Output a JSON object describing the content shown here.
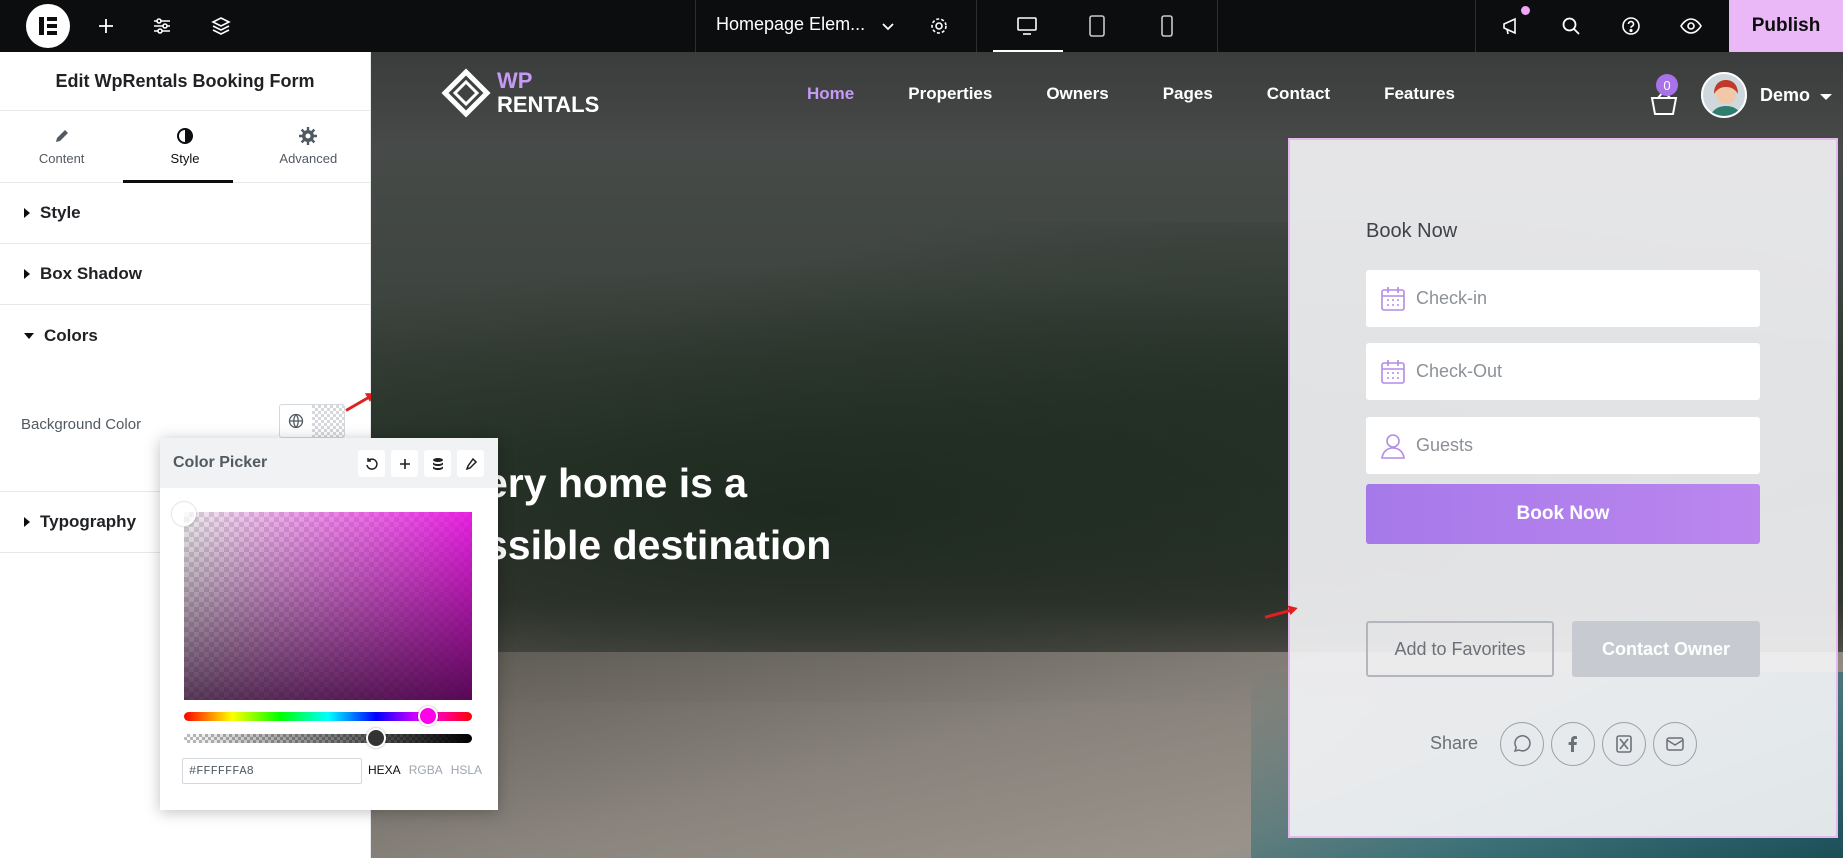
{
  "topbar": {
    "document_title": "Homepage Elem...",
    "publish_label": "Publish",
    "icons": [
      "elementor-logo-icon",
      "plus-icon",
      "sliders-icon",
      "layers-icon",
      "chevron-down-icon",
      "gear-icon",
      "desktop-icon",
      "tablet-icon",
      "mobile-icon",
      "megaphone-icon",
      "search-icon",
      "help-icon",
      "eye-icon"
    ]
  },
  "panel": {
    "title": "Edit WpRentals Booking Form",
    "tabs": [
      {
        "label": "Content",
        "icon": "pencil-icon"
      },
      {
        "label": "Style",
        "icon": "half-circle-icon"
      },
      {
        "label": "Advanced",
        "icon": "gear-icon"
      }
    ],
    "active_tab": "Style",
    "sections": {
      "style": "Style",
      "box_shadow": "Box Shadow",
      "colors": "Colors",
      "typography": "Typography"
    },
    "background_color_label": "Background Color"
  },
  "color_picker": {
    "title": "Color Picker",
    "hex_value": "#FFFFFFA8",
    "formats": [
      "HEXA",
      "RGBA",
      "HSLA"
    ],
    "active_format": "HEXA"
  },
  "site": {
    "logo": {
      "line1": "WP",
      "line2": "RENTALS"
    },
    "nav": [
      "Home",
      "Properties",
      "Owners",
      "Pages",
      "Contact",
      "Features"
    ],
    "active_nav": "Home",
    "cart_count": "0",
    "user_name": "Demo",
    "hero_line1": "ery home is a",
    "hero_line2": "ssible destination"
  },
  "booking_form": {
    "title": "Book Now",
    "checkin_placeholder": "Check-in",
    "checkout_placeholder": "Check-Out",
    "guests_placeholder": "Guests",
    "book_button": "Book Now",
    "favorites_button": "Add to Favorites",
    "contact_button": "Contact Owner",
    "share_label": "Share"
  },
  "colors": {
    "accent": "#a872e8",
    "publish_bg": "#ebb8f7",
    "topbar_bg": "#0c0d0e"
  }
}
